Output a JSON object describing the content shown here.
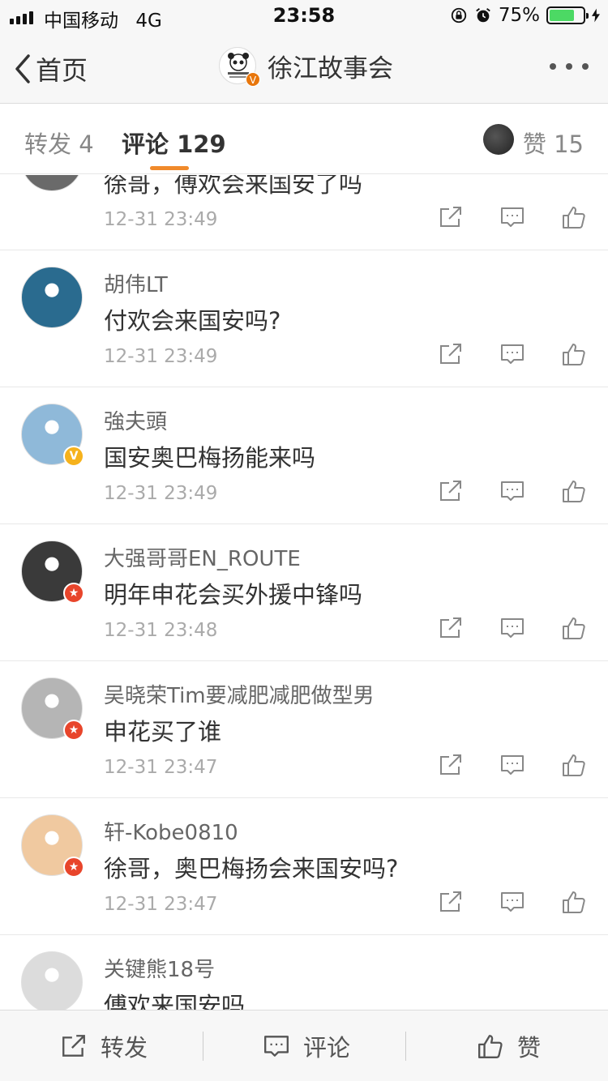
{
  "status_bar": {
    "carrier": "中国移动",
    "network": "4G",
    "time": "23:58",
    "battery": "75%",
    "battery_level": 0.75
  },
  "nav": {
    "back_label": "首页",
    "title": "徐江故事会"
  },
  "tabs": {
    "repost": "转发 4",
    "comment": "评论 129",
    "like": "赞 15"
  },
  "comments": [
    {
      "name": "",
      "text": "徐哥，傅欢会来国安了吗",
      "time": "12-31 23:49",
      "avatar_color": "#6a6a6a",
      "badge": ""
    },
    {
      "name": "胡伟LT",
      "text": "付欢会来国安吗?",
      "time": "12-31 23:49",
      "avatar_color": "#2a6b8f",
      "badge": ""
    },
    {
      "name": "強夫頭",
      "text": "国安奥巴梅扬能来吗",
      "time": "12-31 23:49",
      "avatar_color": "#8fb9d9",
      "badge": "V"
    },
    {
      "name": "大强哥哥EN_ROUTE",
      "text": "明年申花会买外援中锋吗",
      "time": "12-31 23:48",
      "avatar_color": "#3a3a3a",
      "badge": "★"
    },
    {
      "name": "吴晓荣Tim要减肥减肥做型男",
      "text": "申花买了谁",
      "time": "12-31 23:47",
      "avatar_color": "#b5b5b5",
      "badge": "★"
    },
    {
      "name": "轩-Kobe0810",
      "text": "徐哥，奥巴梅扬会来国安吗?",
      "time": "12-31 23:47",
      "avatar_color": "#f0c9a0",
      "badge": "★"
    },
    {
      "name": "关键熊18号",
      "text": "傅欢来国安吗",
      "time": "",
      "avatar_color": "#dcdcdc",
      "badge": ""
    }
  ],
  "bottom_bar": {
    "repost": "转发",
    "comment": "评论",
    "like": "赞"
  },
  "colors": {
    "accent": "#f08a2b",
    "vip_yellow": "#f6b21c",
    "vip_red": "#e8452b",
    "battery_green": "#4cd964"
  }
}
